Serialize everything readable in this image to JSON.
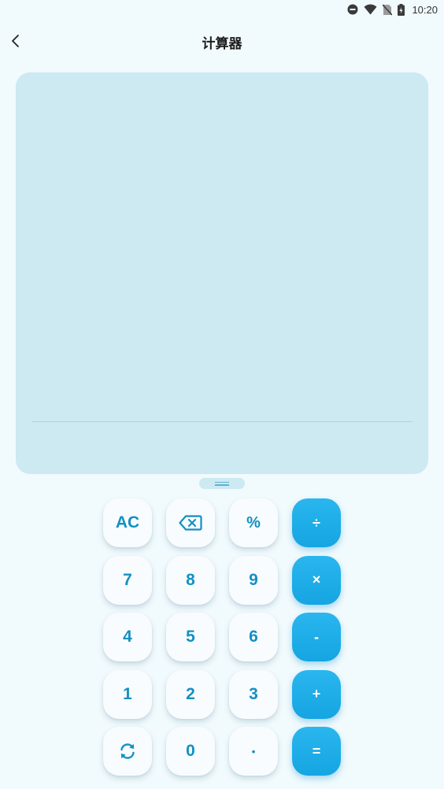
{
  "status_bar": {
    "time": "10:20",
    "icons": [
      "dnd-icon",
      "wifi-icon",
      "no-sim-icon",
      "battery-charging-icon"
    ]
  },
  "header": {
    "title": "计算器",
    "back_icon": "chevron-left-icon"
  },
  "display": {
    "expression": "",
    "result": ""
  },
  "keypad": {
    "rows": [
      [
        {
          "name": "clear-button",
          "label": "AC",
          "type": "func"
        },
        {
          "name": "backspace-button",
          "icon": "backspace-icon",
          "type": "func"
        },
        {
          "name": "percent-button",
          "label": "%",
          "type": "func"
        },
        {
          "name": "divide-button",
          "label": "÷",
          "type": "op"
        }
      ],
      [
        {
          "name": "digit-7-button",
          "label": "7",
          "type": "digit"
        },
        {
          "name": "digit-8-button",
          "label": "8",
          "type": "digit"
        },
        {
          "name": "digit-9-button",
          "label": "9",
          "type": "digit"
        },
        {
          "name": "multiply-button",
          "label": "×",
          "type": "op"
        }
      ],
      [
        {
          "name": "digit-4-button",
          "label": "4",
          "type": "digit"
        },
        {
          "name": "digit-5-button",
          "label": "5",
          "type": "digit"
        },
        {
          "name": "digit-6-button",
          "label": "6",
          "type": "digit"
        },
        {
          "name": "subtract-button",
          "label": "-",
          "type": "op"
        }
      ],
      [
        {
          "name": "digit-1-button",
          "label": "1",
          "type": "digit"
        },
        {
          "name": "digit-2-button",
          "label": "2",
          "type": "digit"
        },
        {
          "name": "digit-3-button",
          "label": "3",
          "type": "digit"
        },
        {
          "name": "add-button",
          "label": "+",
          "type": "op"
        }
      ],
      [
        {
          "name": "toggle-mode-button",
          "icon": "refresh-icon",
          "type": "func"
        },
        {
          "name": "digit-0-button",
          "label": "0",
          "type": "digit"
        },
        {
          "name": "decimal-button",
          "label": "•",
          "type": "digit"
        },
        {
          "name": "equals-button",
          "label": "=",
          "type": "op"
        }
      ]
    ]
  },
  "colors": {
    "background": "#f1fafd",
    "display_bg": "#cde9f2",
    "key_text": "#1390c2",
    "operator_bg": "#1fb0ea"
  }
}
